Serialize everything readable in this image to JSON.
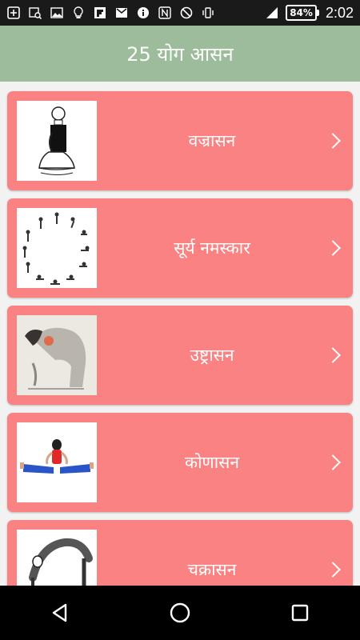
{
  "status_bar": {
    "left_icons": [
      "add-box-icon",
      "image-search-icon",
      "image-icon",
      "lightbulb-icon",
      "flipboard-icon",
      "gmail-icon",
      "info-icon",
      "nfc-icon",
      "do-not-disturb-icon",
      "vibrate-icon"
    ],
    "battery": "84%",
    "time": "2:02"
  },
  "app_bar": {
    "title": "25 योग आसन",
    "color": "#9cbc9c"
  },
  "list": {
    "card_color": "#fb8282",
    "items": [
      {
        "label": "वज्रासन",
        "image": "vajrasana-illustration"
      },
      {
        "label": "सूर्य नमस्कार",
        "image": "surya-namaskar-illustration"
      },
      {
        "label": "उष्ट्रासन",
        "image": "ustrasana-illustration"
      },
      {
        "label": "कोणासन",
        "image": "konasana-illustration"
      },
      {
        "label": "चक्रासन",
        "image": "chakrasana-illustration"
      }
    ]
  },
  "nav_bar": {
    "buttons": [
      "back-icon",
      "home-icon",
      "recents-icon"
    ]
  }
}
